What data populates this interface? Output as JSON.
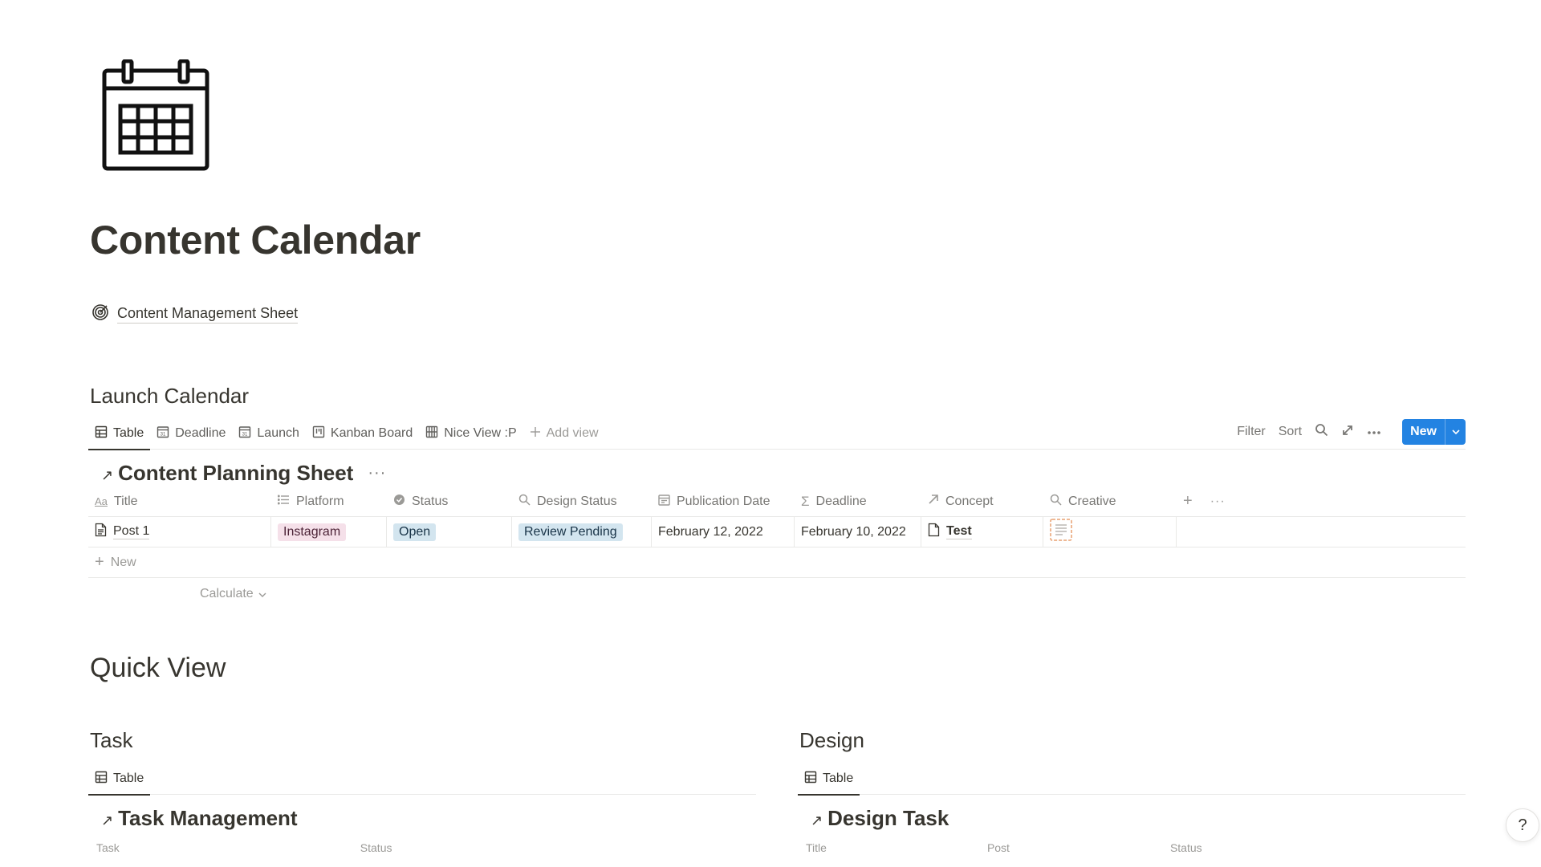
{
  "page": {
    "title": "Content Calendar",
    "icon": "calendar-icon",
    "link": {
      "icon": "target-icon",
      "label": "Content Management Sheet"
    }
  },
  "launch": {
    "heading": "Launch Calendar",
    "tabs": [
      {
        "label": "Table",
        "icon": "table-icon",
        "active": true
      },
      {
        "label": "Deadline",
        "icon": "calendar-view-icon"
      },
      {
        "label": "Launch",
        "icon": "calendar-view-icon"
      },
      {
        "label": "Kanban Board",
        "icon": "board-icon"
      },
      {
        "label": "Nice View :P",
        "icon": "gallery-icon"
      },
      {
        "label": "Add view",
        "icon": "plus-icon"
      }
    ],
    "tools": {
      "filter": "Filter",
      "sort": "Sort",
      "new": "New"
    },
    "db_title": "Content Planning Sheet",
    "columns": [
      "Title",
      "Platform",
      "Status",
      "Design Status",
      "Publication Date",
      "Deadline",
      "Concept",
      "Creative"
    ],
    "rows": [
      {
        "title": "Post 1",
        "platform": "Instagram",
        "status": "Open",
        "design_status": "Review Pending",
        "publication_date": "February 12, 2022",
        "deadline": "February 10, 2022",
        "concept": "Test"
      }
    ],
    "new_row": "New",
    "calculate": "Calculate"
  },
  "quick": {
    "heading": "Quick View",
    "task": {
      "heading": "Task",
      "tab": "Table",
      "db_title": "Task Management",
      "cut_columns": [
        "Task",
        "Status"
      ]
    },
    "design": {
      "heading": "Design",
      "tab": "Table",
      "db_title": "Design Task",
      "cut_columns": [
        "Title",
        "Post",
        "Status"
      ]
    }
  },
  "help": "?",
  "colors": {
    "accent": "#2383e2",
    "text": "#37352f",
    "muted": "#787774",
    "tag_pink": "#f5e0e9",
    "tag_blue": "#d3e5ef"
  }
}
